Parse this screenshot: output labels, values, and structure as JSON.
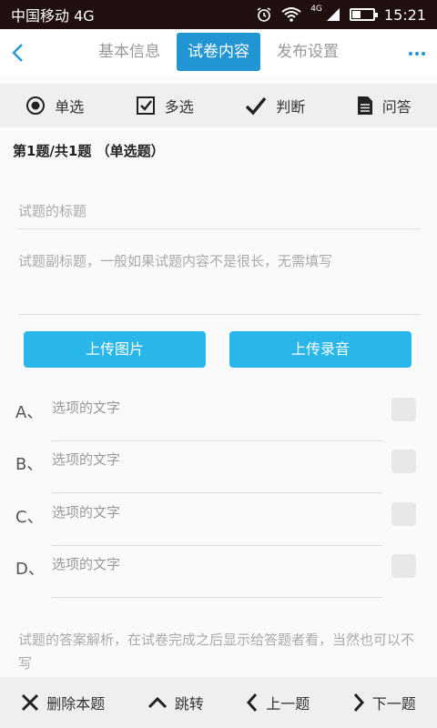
{
  "status_bar": {
    "carrier": "中国移动 4G",
    "network_badge": "4G",
    "time": "15:21",
    "battery_level_percent": 40,
    "icons": [
      "alarm-icon",
      "wifi-icon",
      "signal-icon",
      "battery-icon"
    ]
  },
  "nav": {
    "tabs": [
      {
        "label": "基本信息",
        "active": false
      },
      {
        "label": "试卷内容",
        "active": true
      },
      {
        "label": "发布设置",
        "active": false
      }
    ],
    "back_icon": "chevron-left-icon",
    "more_icon": "ellipsis-icon"
  },
  "question_types": [
    {
      "label": "单选",
      "icon": "radio-icon"
    },
    {
      "label": "多选",
      "icon": "checkbox-icon"
    },
    {
      "label": "判断",
      "icon": "checkmark-icon"
    },
    {
      "label": "问答",
      "icon": "document-icon"
    }
  ],
  "question_header": "第1题/共1题 （单选题）",
  "form": {
    "title_placeholder": "试题的标题",
    "subtitle_placeholder": "试题副标题，一般如果试题内容不是很长，无需填写",
    "upload_image": "上传图片",
    "upload_audio": "上传录音",
    "options": [
      {
        "letter": "A、",
        "placeholder": "选项的文字"
      },
      {
        "letter": "B、",
        "placeholder": "选项的文字"
      },
      {
        "letter": "C、",
        "placeholder": "选项的文字"
      },
      {
        "letter": "D、",
        "placeholder": "选项的文字"
      }
    ],
    "explanation_placeholder": "试题的答案解析，在试卷完成之后显示给答题者看，当然也可以不写"
  },
  "bottom_bar": {
    "delete": "删除本题",
    "jump": "跳转",
    "prev": "上一题",
    "next": "下一题"
  },
  "colors": {
    "accent": "#2196d3",
    "button": "#29b6e8",
    "status_bar": "#1f0f0f"
  }
}
